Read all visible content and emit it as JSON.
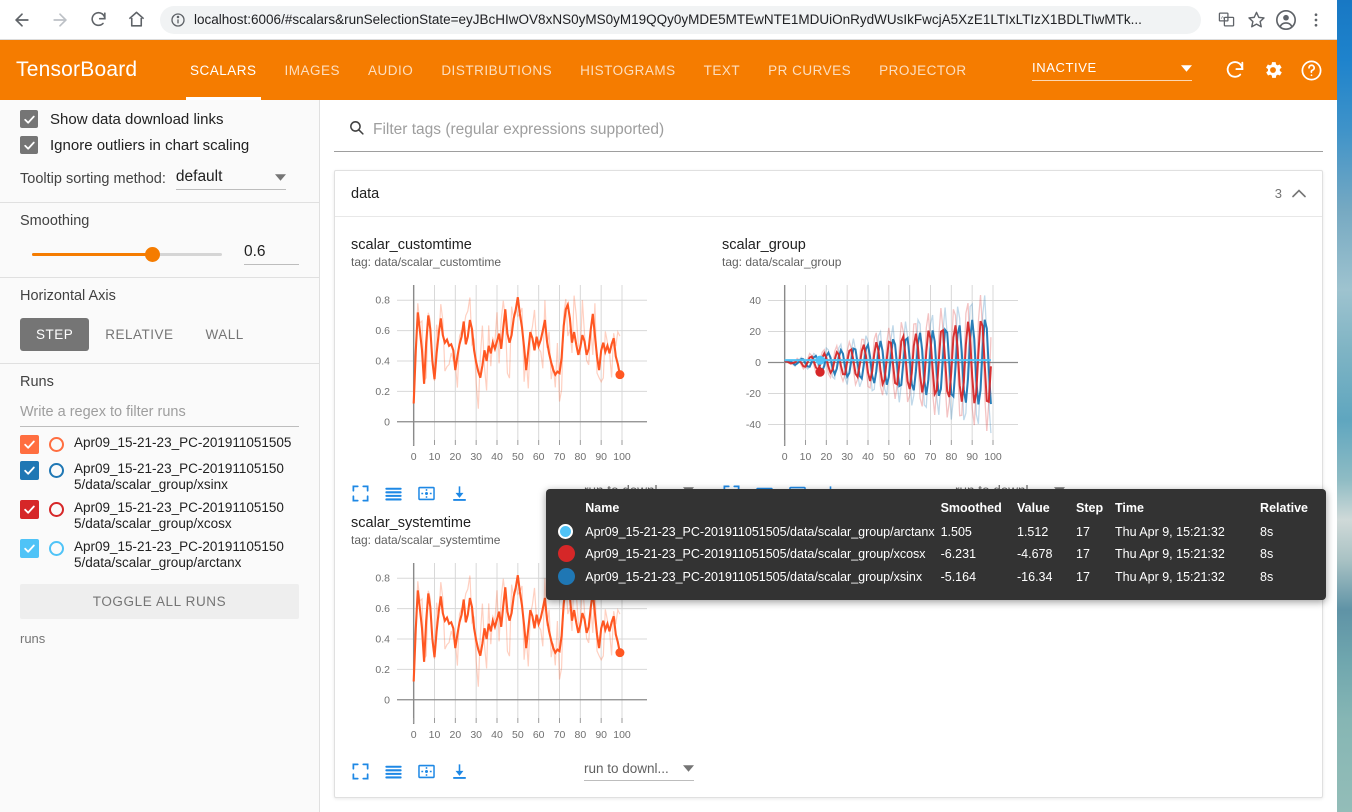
{
  "browser": {
    "back_icon": "back-arrow-icon",
    "forward_icon": "forward-arrow-icon",
    "reload_icon": "reload-icon",
    "home_icon": "home-icon",
    "info_icon": "site-info-icon",
    "url": "localhost:6006/#scalars&runSelectionState=eyJBcHIwOV8xNS0yMS0yM19QQy0yMDE5MTEwNTE1MDUiOnRydWUsIkFwcjA5XzE1LTIxLTIzX1BDLTIwMTk...",
    "translate_icon": "translate-icon",
    "bookmark_icon": "star-icon",
    "profile_icon": "account-icon",
    "menu_icon": "three-dot-menu-icon"
  },
  "header": {
    "logo": "TensorBoard",
    "tabs": [
      {
        "label": "SCALARS",
        "active": true
      },
      {
        "label": "IMAGES",
        "active": false
      },
      {
        "label": "AUDIO",
        "active": false
      },
      {
        "label": "DISTRIBUTIONS",
        "active": false
      },
      {
        "label": "HISTOGRAMS",
        "active": false
      },
      {
        "label": "TEXT",
        "active": false
      },
      {
        "label": "PR CURVES",
        "active": false
      },
      {
        "label": "PROJECTOR",
        "active": false
      }
    ],
    "reload_mode": "INACTIVE",
    "reload_icon": "refresh-icon",
    "settings_icon": "gear-icon",
    "help_icon": "help-circle-icon",
    "accent_color": "#f57c00"
  },
  "sidebar": {
    "checkboxes": [
      {
        "label": "Show data download links",
        "checked": true
      },
      {
        "label": "Ignore outliers in chart scaling",
        "checked": true
      }
    ],
    "tooltip_sorting": {
      "label": "Tooltip sorting method:",
      "value": "default"
    },
    "smoothing": {
      "title": "Smoothing",
      "value": "0.6",
      "fraction": 0.6
    },
    "horizontal_axis": {
      "title": "Horizontal Axis",
      "options": [
        {
          "label": "STEP",
          "active": true
        },
        {
          "label": "RELATIVE",
          "active": false
        },
        {
          "label": "WALL",
          "active": false
        }
      ]
    },
    "runs": {
      "title": "Runs",
      "filter_placeholder": "Write a regex to filter runs",
      "items": [
        {
          "name": "Apr09_15-21-23_PC-201911051505",
          "color": "#ff6e40",
          "checked": true
        },
        {
          "name": "Apr09_15-21-23_PC-201911051505/data/scalar_group/xsinx",
          "color": "#1f77b4",
          "checked": true
        },
        {
          "name": "Apr09_15-21-23_PC-201911051505/data/scalar_group/xcosx",
          "color": "#d62728",
          "checked": true
        },
        {
          "name": "Apr09_15-21-23_PC-201911051505/data/scalar_group/arctanx",
          "color": "#4fc3f7",
          "checked": true
        }
      ],
      "toggle_all_label": "TOGGLE ALL RUNS",
      "caption": "runs"
    }
  },
  "main": {
    "filter": {
      "icon": "search-icon",
      "placeholder": "Filter tags (regular expressions supported)"
    },
    "card": {
      "title": "data",
      "count": "3",
      "collapse_icon": "chevron-up-icon"
    },
    "chart_tools": {
      "fullscreen_icon": "expand-icon",
      "lines_icon": "data-series-icon",
      "fit_icon": "fit-domain-icon",
      "download_icon": "download-icon",
      "run_select_label": "run to downl...",
      "run_select_caret": "chevron-down-icon"
    }
  },
  "tooltip": {
    "columns": [
      "Name",
      "Smoothed",
      "Value",
      "Step",
      "Time",
      "Relative"
    ],
    "rows": [
      {
        "color": "#4fc3f7",
        "name": "Apr09_15-21-23_PC-201911051505/data/scalar_group/arctanx",
        "smoothed": "1.505",
        "value": "1.512",
        "step": "17",
        "time": "Thu Apr 9, 15:21:32",
        "relative": "8s"
      },
      {
        "color": "#d62728",
        "name": "Apr09_15-21-23_PC-201911051505/data/scalar_group/xcosx",
        "smoothed": "-6.231",
        "value": "-4.678",
        "step": "17",
        "time": "Thu Apr 9, 15:21:32",
        "relative": "8s"
      },
      {
        "color": "#1f77b4",
        "name": "Apr09_15-21-23_PC-201911051505/data/scalar_group/xsinx",
        "smoothed": "-5.164",
        "value": "-16.34",
        "step": "17",
        "time": "Thu Apr 9, 15:21:32",
        "relative": "8s"
      }
    ]
  },
  "chart_data": [
    {
      "type": "line",
      "title": "scalar_customtime",
      "tag": "tag: data/scalar_customtime",
      "xlabel": "",
      "ylabel": "",
      "xticks": [
        0,
        10,
        20,
        30,
        40,
        50,
        60,
        70,
        80,
        90,
        100
      ],
      "yticks": [
        0,
        0.2,
        0.4,
        0.6,
        0.8
      ],
      "xlim": [
        -8,
        112
      ],
      "ylim": [
        -0.12,
        0.9
      ],
      "grid": true,
      "legend": "none",
      "series": [
        {
          "name": "Apr09_15-21-23_PC-201911051505",
          "color": "#ff5722",
          "x": [
            0,
            1,
            2,
            3,
            4,
            5,
            6,
            7,
            8,
            9,
            10,
            11,
            12,
            13,
            14,
            15,
            16,
            17,
            18,
            19,
            20,
            21,
            22,
            23,
            24,
            25,
            26,
            27,
            28,
            29,
            30,
            31,
            32,
            33,
            34,
            35,
            36,
            37,
            38,
            39,
            40,
            41,
            42,
            43,
            44,
            45,
            46,
            47,
            48,
            49,
            50,
            51,
            52,
            53,
            54,
            55,
            56,
            57,
            58,
            59,
            60,
            61,
            62,
            63,
            64,
            65,
            66,
            67,
            68,
            69,
            70,
            71,
            72,
            73,
            74,
            75,
            76,
            77,
            78,
            79,
            80,
            81,
            82,
            83,
            84,
            85,
            86,
            87,
            88,
            89,
            90,
            91,
            92,
            93,
            94,
            95,
            96,
            97,
            98,
            99
          ],
          "values": [
            0.12,
            0.47,
            0.72,
            0.6,
            0.47,
            0.25,
            0.52,
            0.7,
            0.61,
            0.4,
            0.28,
            0.45,
            0.58,
            0.68,
            0.57,
            0.52,
            0.54,
            0.5,
            0.51,
            0.47,
            0.34,
            0.43,
            0.51,
            0.56,
            0.66,
            0.51,
            0.56,
            0.67,
            0.61,
            0.47,
            0.39,
            0.33,
            0.29,
            0.37,
            0.47,
            0.4,
            0.5,
            0.45,
            0.52,
            0.48,
            0.53,
            0.58,
            0.48,
            0.62,
            0.74,
            0.58,
            0.52,
            0.57,
            0.68,
            0.74,
            0.82,
            0.71,
            0.62,
            0.49,
            0.34,
            0.47,
            0.59,
            0.55,
            0.47,
            0.56,
            0.5,
            0.54,
            0.6,
            0.67,
            0.53,
            0.45,
            0.39,
            0.34,
            0.31,
            0.33,
            0.32,
            0.42,
            0.63,
            0.74,
            0.77,
            0.68,
            0.52,
            0.59,
            0.51,
            0.44,
            0.49,
            0.57,
            0.53,
            0.44,
            0.48,
            0.61,
            0.71,
            0.57,
            0.43,
            0.34,
            0.47,
            0.52,
            0.46,
            0.5,
            0.45,
            0.51,
            0.55,
            0.43,
            0.38,
            0.31
          ],
          "final_point": {
            "x": 99,
            "y": 0.31
          }
        }
      ]
    },
    {
      "type": "line",
      "title": "scalar_group",
      "tag": "tag: data/scalar_group",
      "xlabel": "",
      "ylabel": "",
      "xticks": [
        0,
        10,
        20,
        30,
        40,
        50,
        60,
        70,
        80,
        90,
        100
      ],
      "yticks": [
        -40,
        -20,
        0,
        20,
        40
      ],
      "xlim": [
        -8,
        112
      ],
      "ylim": [
        -50,
        50
      ],
      "grid": true,
      "legend": "none",
      "series": [
        {
          "name": "xsinx",
          "color": "#1f77b4",
          "amplitude_growth": 0.46,
          "period": 6.3,
          "phase": 0
        },
        {
          "name": "xcosx",
          "color": "#d62728",
          "amplitude_growth": 0.46,
          "period": 6.3,
          "phase": 1.57
        },
        {
          "name": "arctanx",
          "color": "#4fc3f7",
          "constant": 1.5
        }
      ],
      "markers": [
        {
          "x": 17,
          "y": 1.5,
          "color": "#4fc3f7"
        },
        {
          "x": 17,
          "y": -6.2,
          "color": "#d62728"
        }
      ]
    },
    {
      "type": "line",
      "title": "scalar_systemtime",
      "tag": "tag: data/scalar_systemtime",
      "xlabel": "",
      "ylabel": "",
      "xticks": [
        0,
        10,
        20,
        30,
        40,
        50,
        60,
        70,
        80,
        90,
        100
      ],
      "yticks": [
        0,
        0.2,
        0.4,
        0.6,
        0.8
      ],
      "xlim": [
        -8,
        112
      ],
      "ylim": [
        -0.12,
        0.9
      ],
      "grid": true,
      "legend": "none",
      "series": [
        {
          "name": "Apr09_15-21-23_PC-201911051505",
          "color": "#ff5722",
          "x": [
            0,
            1,
            2,
            3,
            4,
            5,
            6,
            7,
            8,
            9,
            10,
            11,
            12,
            13,
            14,
            15,
            16,
            17,
            18,
            19,
            20,
            21,
            22,
            23,
            24,
            25,
            26,
            27,
            28,
            29,
            30,
            31,
            32,
            33,
            34,
            35,
            36,
            37,
            38,
            39,
            40,
            41,
            42,
            43,
            44,
            45,
            46,
            47,
            48,
            49,
            50,
            51,
            52,
            53,
            54,
            55,
            56,
            57,
            58,
            59,
            60,
            61,
            62,
            63,
            64,
            65,
            66,
            67,
            68,
            69,
            70,
            71,
            72,
            73,
            74,
            75,
            76,
            77,
            78,
            79,
            80,
            81,
            82,
            83,
            84,
            85,
            86,
            87,
            88,
            89,
            90,
            91,
            92,
            93,
            94,
            95,
            96,
            97,
            98,
            99
          ],
          "values": [
            0.12,
            0.47,
            0.72,
            0.6,
            0.47,
            0.25,
            0.52,
            0.7,
            0.61,
            0.4,
            0.28,
            0.45,
            0.58,
            0.68,
            0.57,
            0.52,
            0.54,
            0.5,
            0.51,
            0.47,
            0.34,
            0.43,
            0.51,
            0.56,
            0.66,
            0.51,
            0.56,
            0.67,
            0.61,
            0.47,
            0.39,
            0.33,
            0.29,
            0.37,
            0.47,
            0.4,
            0.5,
            0.45,
            0.52,
            0.48,
            0.53,
            0.58,
            0.48,
            0.62,
            0.74,
            0.58,
            0.52,
            0.57,
            0.68,
            0.74,
            0.82,
            0.71,
            0.62,
            0.49,
            0.34,
            0.47,
            0.59,
            0.55,
            0.47,
            0.56,
            0.5,
            0.54,
            0.6,
            0.67,
            0.53,
            0.45,
            0.39,
            0.34,
            0.31,
            0.33,
            0.32,
            0.42,
            0.63,
            0.74,
            0.77,
            0.68,
            0.52,
            0.59,
            0.51,
            0.44,
            0.49,
            0.57,
            0.53,
            0.44,
            0.48,
            0.61,
            0.71,
            0.57,
            0.43,
            0.34,
            0.47,
            0.52,
            0.46,
            0.5,
            0.45,
            0.51,
            0.55,
            0.43,
            0.38,
            0.31
          ],
          "final_point": {
            "x": 99,
            "y": 0.31
          }
        }
      ]
    }
  ]
}
